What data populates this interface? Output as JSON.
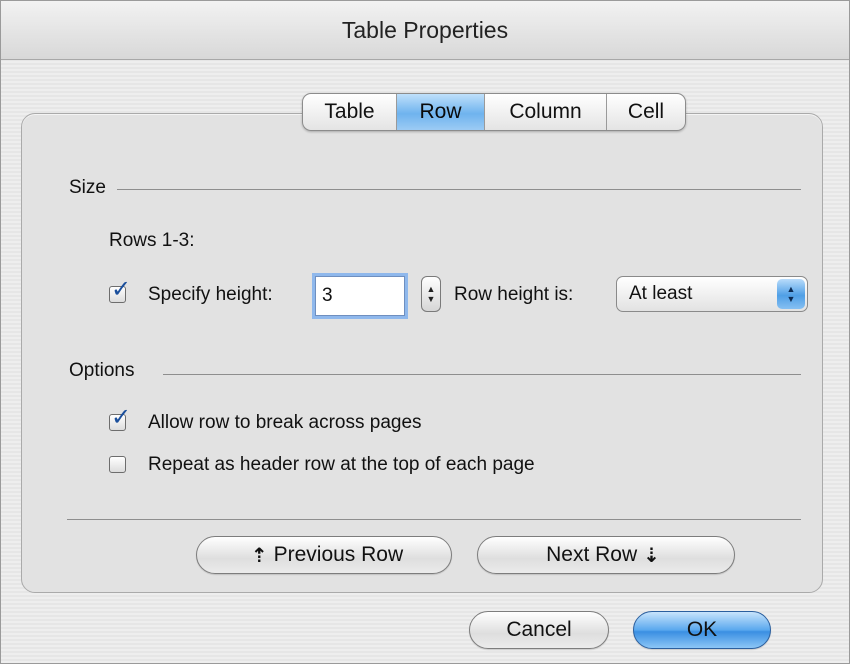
{
  "window": {
    "title": "Table Properties"
  },
  "tabs": [
    {
      "label": "Table"
    },
    {
      "label": "Row"
    },
    {
      "label": "Column"
    },
    {
      "label": "Cell"
    }
  ],
  "size_section": {
    "title": "Size",
    "rows_label": "Rows 1-3:",
    "specify_height_label": "Specify height:",
    "specify_height_checked": true,
    "height_value": "3",
    "row_height_is_label": "Row height is:",
    "row_height_mode": "At least"
  },
  "options_section": {
    "title": "Options",
    "allow_break_label": "Allow row to break across pages",
    "allow_break_checked": true,
    "repeat_header_label": "Repeat as header row at the top of each page",
    "repeat_header_checked": false
  },
  "navigation": {
    "previous_label": "Previous Row",
    "next_label": "Next Row"
  },
  "footer": {
    "cancel_label": "Cancel",
    "ok_label": "OK"
  },
  "colors": {
    "accent_blue": "#6fb3ee",
    "checkmark": "#1b4f9c"
  }
}
